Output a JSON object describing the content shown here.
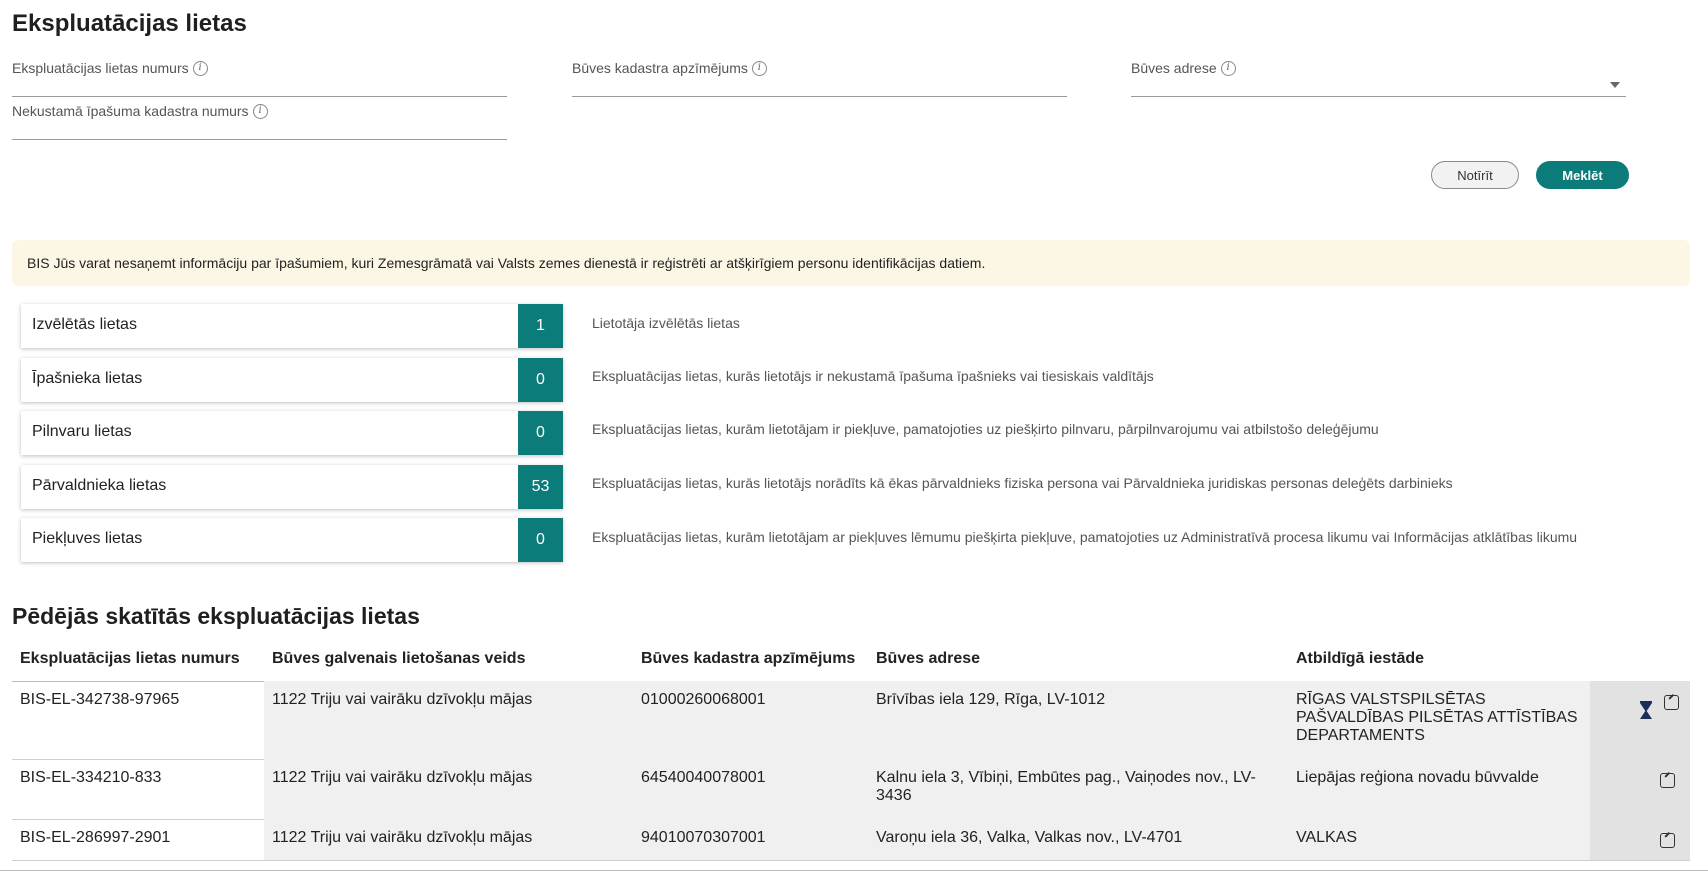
{
  "page": {
    "title": "Ekspluatācijas lietas"
  },
  "filters": {
    "case_number": {
      "label": "Ekspluatācijas lietas numurs",
      "value": ""
    },
    "building_cadastre": {
      "label": "Būves kadastra apzīmējums",
      "value": ""
    },
    "building_address": {
      "label": "Būves adrese",
      "value": ""
    },
    "property_cadastre": {
      "label": "Nekustamā īpašuma kadastra numurs",
      "value": ""
    },
    "info_glyph": "i"
  },
  "buttons": {
    "clear": "Notīrīt",
    "search": "Meklēt"
  },
  "notice": {
    "text": "BIS Jūs varat nesaņemt informāciju par īpašumiem, kuri Zemesgrāmatā vai Valsts zemes dienestā ir reģistrēti ar atšķirīgiem personu identifikācijas datiem."
  },
  "categories": [
    {
      "label": "Izvēlētās lietas",
      "count": "1",
      "description": "Lietotāja izvēlētās lietas"
    },
    {
      "label": "Īpašnieka lietas",
      "count": "0",
      "description": "Ekspluatācijas lietas, kurās lietotājs ir nekustamā īpašuma īpašnieks vai tiesiskais valdītājs"
    },
    {
      "label": "Pilnvaru lietas",
      "count": "0",
      "description": "Ekspluatācijas lietas, kurām lietotājam ir piekļuve, pamatojoties uz piešķirto pilnvaru, pārpilnvarojumu vai atbilstošo deleģējumu"
    },
    {
      "label": "Pārvaldnieka lietas",
      "count": "53",
      "description": "Ekspluatācijas lietas, kurās lietotājs norādīts kā ēkas pārvaldnieks fiziska persona vai Pārvaldnieka juridiskas personas deleģēts darbinieks"
    },
    {
      "label": "Piekļuves lietas",
      "count": "0",
      "description": "Ekspluatācijas lietas, kurām lietotājam ar piekļuves lēmumu piešķirta piekļuve, pamatojoties uz Administratīvā procesa likumu vai Informācijas atklātības likumu"
    }
  ],
  "recent": {
    "title": "Pēdējās skatītās ekspluatācijas lietas",
    "columns": [
      "Ekspluatācijas lietas numurs",
      "Būves galvenais lietošanas veids",
      "Būves kadastra apzīmējums",
      "Būves adrese",
      "Atbildīgā iestāde"
    ],
    "rows": [
      {
        "number": "BIS-EL-342738-97965",
        "usage": "1122 Triju vai vairāku dzīvokļu mājas",
        "cadastre": "01000260068001",
        "address": "Brīvības iela 129, Rīga, LV-1012",
        "authority": "RĪGAS VALSTSPILSĒTAS PAŠVALDĪBAS PILSĒTAS ATTĪSTĪBAS DEPARTAMENTS",
        "icons": [
          "pin-icon",
          "external-link-icon"
        ]
      },
      {
        "number": "BIS-EL-334210-833",
        "usage": "1122 Triju vai vairāku dzīvokļu mājas",
        "cadastre": "64540040078001",
        "address": "Kalnu iela 3, Vībiņi, Embūtes pag., Vaiņodes nov., LV-3436",
        "authority": "Liepājas reģiona novadu būvvalde",
        "icons": [
          "external-link-icon"
        ]
      },
      {
        "number": "BIS-EL-286997-2901",
        "usage": "1122 Triju vai vairāku dzīvokļu mājas",
        "cadastre": "94010070307001",
        "address": "Varoņu iela 36, Valka, Valkas nov., LV-4701",
        "authority": "VALKAS",
        "icons": [
          "external-link-icon"
        ]
      }
    ]
  },
  "colors": {
    "accent": "#0c7c7a",
    "notice_bg": "#fcf6e5"
  }
}
